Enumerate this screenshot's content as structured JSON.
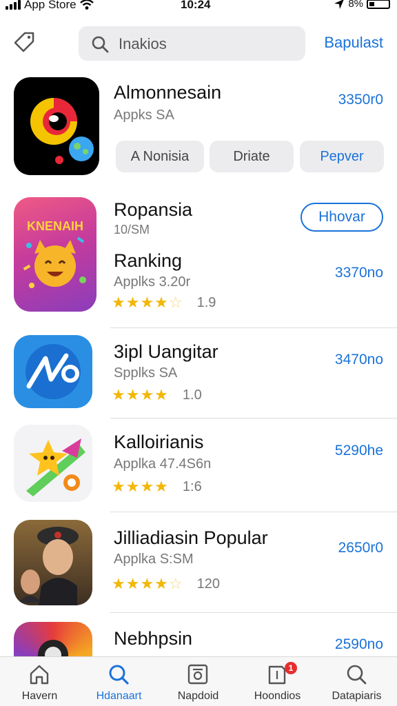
{
  "status_bar": {
    "carrier": "App Store",
    "time": "10:24",
    "battery": "8%"
  },
  "header": {
    "search_placeholder": "Inakios",
    "action_label": "Bapulast"
  },
  "featured": {
    "name": "Almonnesain",
    "subtitle": "Appks SA",
    "price": "3350r0",
    "chips": [
      "A Nonisia",
      "Driate",
      "Pepver"
    ]
  },
  "apps": [
    {
      "name": "Ropansia",
      "subtitle": "10/SM",
      "button_label": "Hhovar",
      "icon_text": "KNENAIH"
    },
    {
      "name": "Ranking",
      "subtitle": "Applks 3.20r",
      "price": "3370no",
      "stars": 4,
      "rating": "1.9"
    },
    {
      "name": "3ipl Uangitar",
      "subtitle": "Spplks SA",
      "price": "3470no",
      "stars": 4,
      "rating": "1.0"
    },
    {
      "name": "Kalloirianis",
      "subtitle": "Applka 47.4S6n",
      "price": "5290he",
      "stars": 4,
      "rating": "1:6"
    },
    {
      "name": "Jilliadiasin Popular",
      "subtitle": "Applka S:SM",
      "price": "2650r0",
      "stars": 4,
      "rating": "120"
    },
    {
      "name": "Nebhpsin",
      "price": "2590no"
    }
  ],
  "tabs": [
    {
      "label": "Havern",
      "icon": "home-icon"
    },
    {
      "label": "Hdanaart",
      "icon": "search-icon",
      "active": true
    },
    {
      "label": "Napdoid",
      "icon": "apps-icon"
    },
    {
      "label": "Hoondios",
      "icon": "updates-icon",
      "badge": "1"
    },
    {
      "label": "Datapiaris",
      "icon": "search-icon"
    }
  ],
  "colors": {
    "accent": "#1a72d9",
    "star": "#f2b707",
    "badge": "#e62e2e"
  }
}
